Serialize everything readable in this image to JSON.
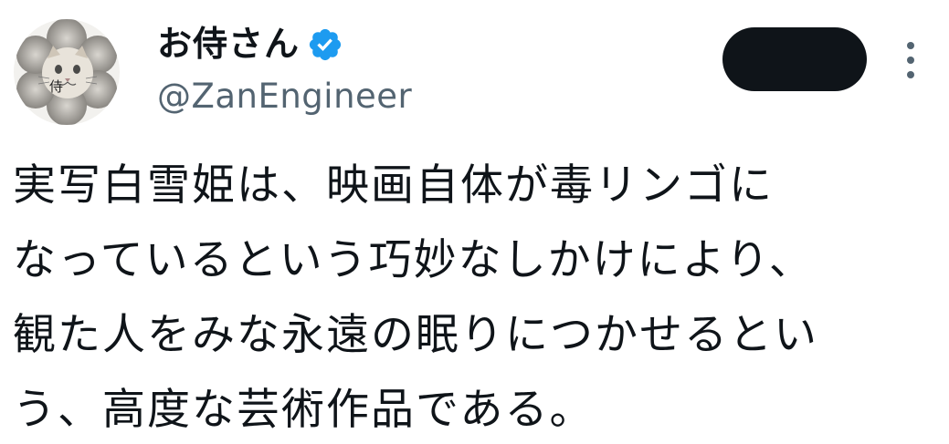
{
  "author": {
    "display_name": "お侍さん",
    "handle": "@ZanEngineer",
    "avatar_text": "侍",
    "verified": true
  },
  "follow_button": {
    "label": ""
  },
  "tweet": {
    "lines": [
      "実写白雪姫は、映画自体が毒リンゴに",
      "なっているという巧妙なしかけにより、",
      "観た人をみな永遠の眠りにつかせるとい",
      "う、高度な芸術作品である。"
    ]
  },
  "colors": {
    "text": "#0f1419",
    "secondary_text": "#536471",
    "verified_badge": "#1d9bf0",
    "follow_button_bg": "#0f1419"
  },
  "icons": {
    "verified": "verified-badge-icon",
    "more": "more-options-icon"
  }
}
